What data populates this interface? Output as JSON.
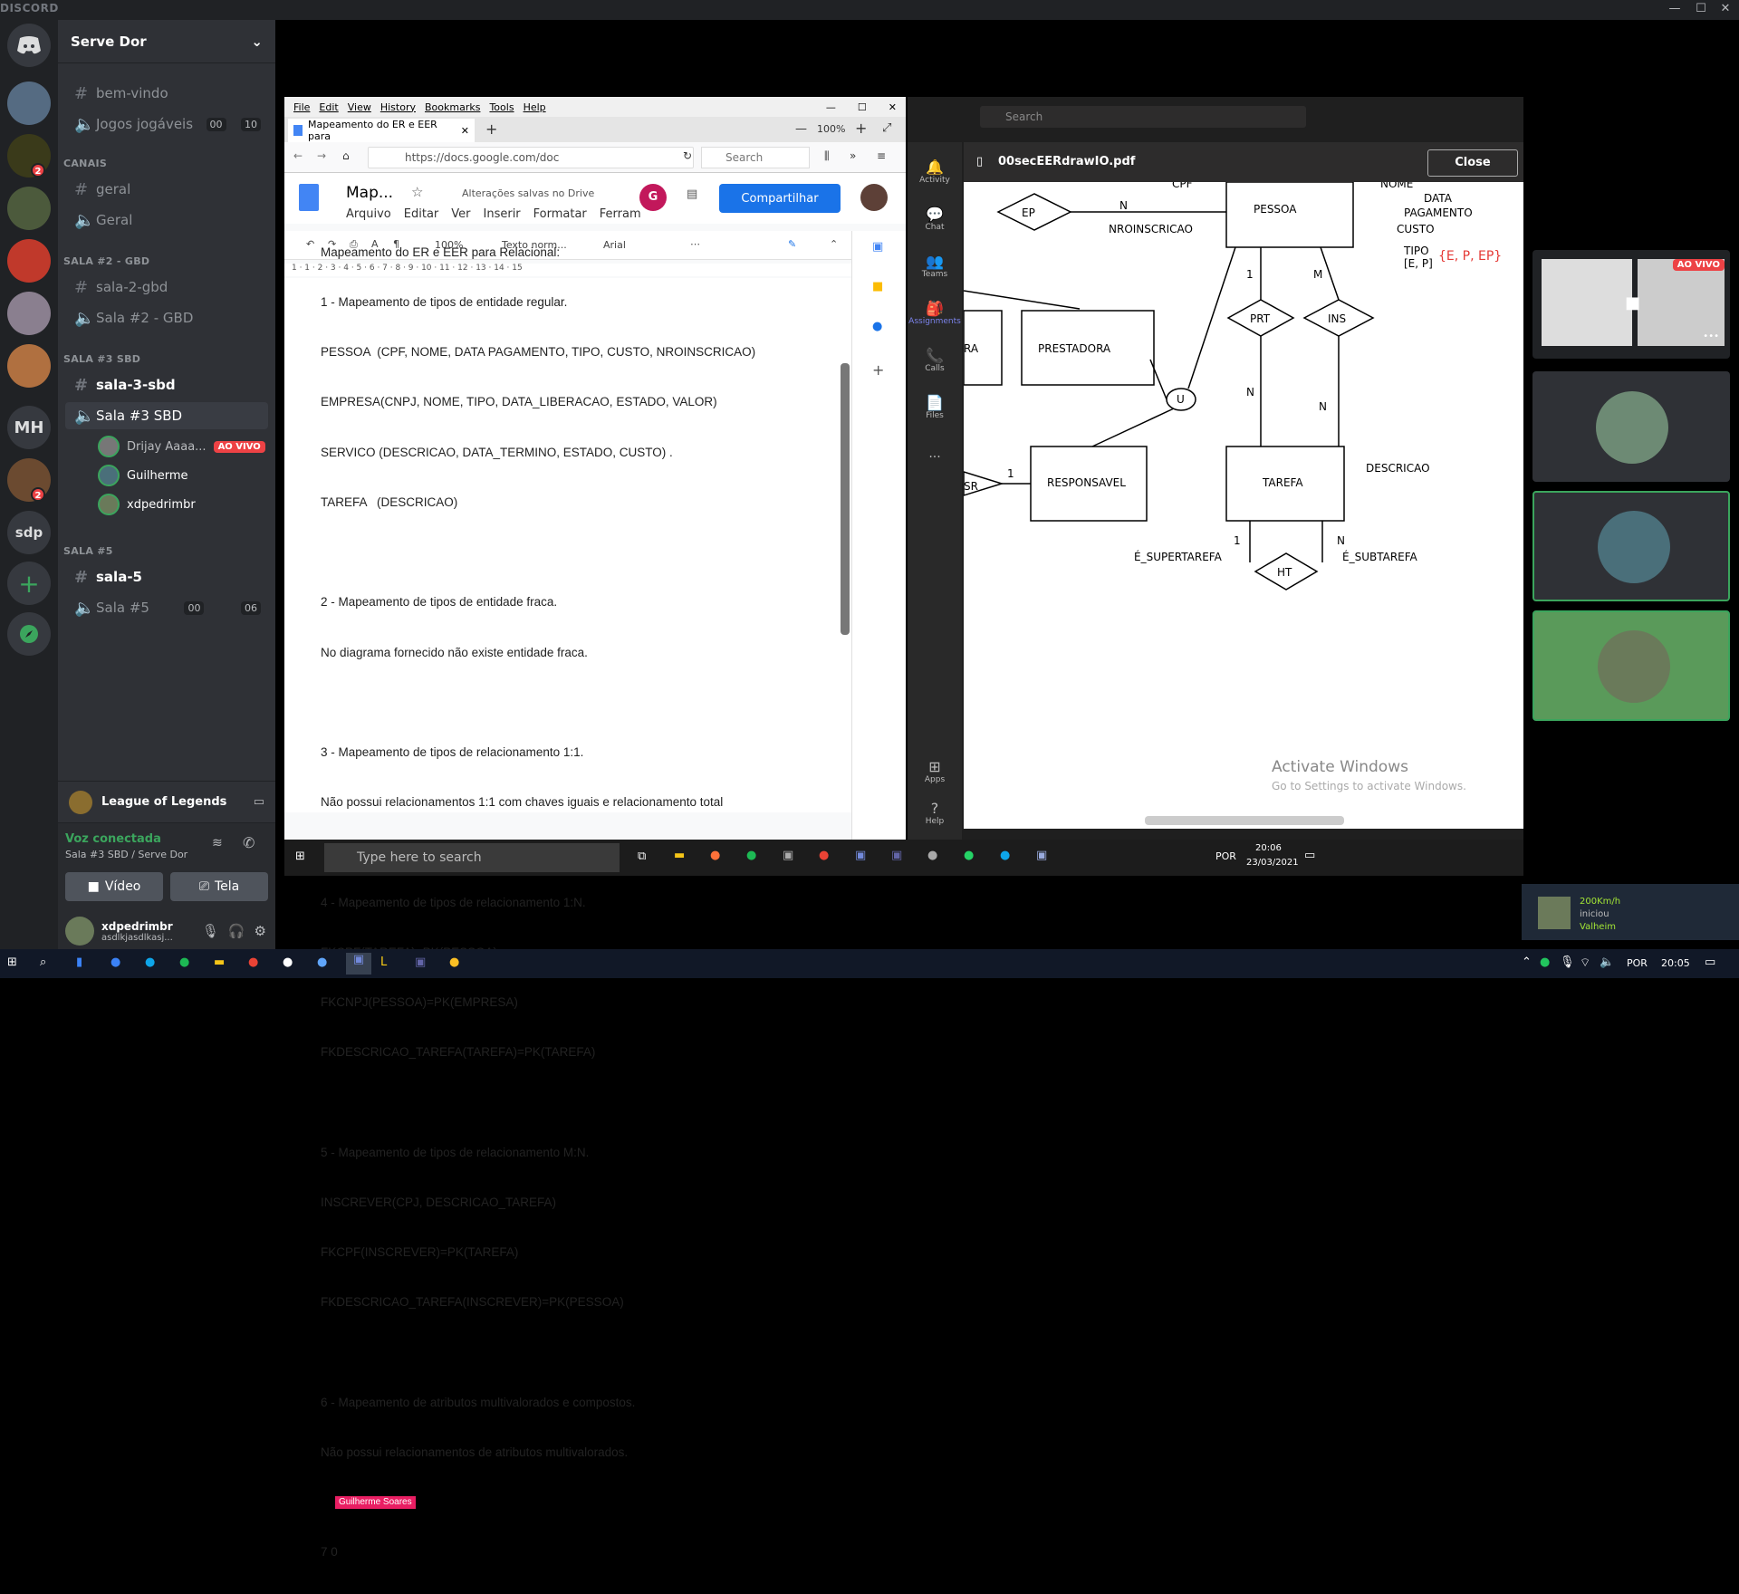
{
  "window": {
    "brand": "DISCORD",
    "min": "—",
    "max": "☐",
    "close": "✕"
  },
  "server": {
    "name": "Serve Dor",
    "chevron": "⌄"
  },
  "guild_badges": [
    "2",
    "2"
  ],
  "guild_labels": {
    "mh": "MH",
    "sdp": "sdp"
  },
  "channels": {
    "bem_vindo": "bem-vindo",
    "jogos": "Jogos jogáveis",
    "jogos_count1": "00",
    "jogos_count2": "10",
    "cat_canais": "CANAIS",
    "geral": "geral",
    "Geral": "Geral",
    "cat_sala2": "SALA #2 - GBD",
    "sala2gbd": "sala-2-gbd",
    "sala2voice": "Sala #2 - GBD",
    "cat_sala3": "SALA #3 SBD",
    "sala3sbd": "sala-3-sbd",
    "sala3voice": "Sala #3 SBD",
    "cat_sala5": "SALA #5",
    "sala5": "sala-5",
    "sala5voice": "Sala #5",
    "sala5_count1": "00",
    "sala5_count2": "06"
  },
  "voice_users": [
    {
      "name": "Drijay Aaaa...",
      "live": "AO VIVO"
    },
    {
      "name": "Guilherme"
    },
    {
      "name": "xdpedrimbr"
    }
  ],
  "activity": {
    "game": "League of Legends"
  },
  "voice": {
    "status": "Voz conectada",
    "where": "Sala #3 SBD / Serve Dor",
    "video": "Vídeo",
    "screen": "Tela"
  },
  "user": {
    "name": "xdpedrimbr",
    "status": "asdlkjasdlkasj..."
  },
  "firefox": {
    "menus": [
      "File",
      "Edit",
      "View",
      "History",
      "Bookmarks",
      "Tools",
      "Help"
    ],
    "tab_title": "Mapeamento do ER e EER para",
    "zoom": "100%",
    "url": "https://docs.google.com/doc",
    "search_placeholder": "Search"
  },
  "gdocs": {
    "title": "Map...",
    "saved": "Alterações salvas no Drive",
    "menus": [
      "Arquivo",
      "Editar",
      "Ver",
      "Inserir",
      "Formatar",
      "Ferram"
    ],
    "share": "Compartilhar",
    "avatar_letter": "G",
    "zoom": "100%",
    "style": "Texto norm...",
    "font": "Arial",
    "ruler": "1  ·  1  ·  2  ·  3  ·  4  ·  5  ·  6  ·  7  ·  8  ·  9  ·  10  ·  11  ·  12  ·  13  ·  14  ·  15",
    "cursor_label": "Guilherme Soares",
    "lines": [
      "Mapeamento do ER e EER para Relacional:",
      "1 - Mapeamento de tipos de entidade regular.",
      "PESSOA  (CPF, NOME, DATA PAGAMENTO, TIPO, CUSTO, NROINSCRICAO)",
      "EMPRESA(CNPJ, NOME, TIPO, DATA_LIBERACAO, ESTADO, VALOR)",
      "SERVICO (DESCRICAO, DATA_TERMINO, ESTADO, CUSTO) .",
      "TAREFA   (DESCRICAO)",
      "",
      "2 - Mapeamento de tipos de entidade fraca.",
      "No diagrama fornecido não existe entidade fraca.",
      "",
      "3 - Mapeamento de tipos de relacionamento 1:1.",
      "Não possui relacionamentos 1:1 com chaves iguais e relacionamento total",
      "",
      "4 - Mapeamento de tipos de relacionamento 1:N.",
      "FKCPF(TAREFA)=PK(PESSOA)",
      "FKCNPJ(PESSOA)=PK(EMPRESA)",
      "FKDESCRICAO_TAREFA(TAREFA)=PK(TAREFA)",
      "",
      "5 - Mapeamento de tipos de relacionamento M:N.",
      "INSCREVER(CPJ, DESCRICAO_TAREFA)",
      "FKCPF(INSCREVER)=PK(TAREFA)",
      "FKDESCRICAO_TAREFA(INSCREVER)=PK(PESSOA)",
      "",
      "6 - Mapeamento de atributos multivalorados e compostos.",
      "Não possui relacionamentos de atributos multivalorados.",
      "",
      "7 0"
    ]
  },
  "teams": {
    "search": "Search",
    "rail": [
      "Activity",
      "Chat",
      "Teams",
      "Assignments",
      "Calls",
      "Files",
      "...",
      "Apps",
      "Help"
    ],
    "pdf_name": "00secEERdrawIO.pdf",
    "close": "Close",
    "watermark1": "Activate Windows",
    "watermark2": "Go to Settings to activate Windows.",
    "diagram": {
      "entities": [
        "PESSOA",
        "PRESTADORA",
        "RESPONSAVEL",
        "TAREFA",
        "RA",
        "SR"
      ],
      "rels": [
        "EP",
        "PRT",
        "INS",
        "HT",
        "U"
      ],
      "attrs": [
        "CPF",
        "NOME",
        "DATA",
        "PAGAMENTO",
        "CUSTO",
        "TIPO",
        "[E, P]",
        "NROINSCRICAO",
        "DESCRICAO",
        "É_SUPERTAREFA",
        "É_SUBTAREFA"
      ],
      "card": [
        "N",
        "1",
        "M",
        "N",
        "N",
        "1",
        "1",
        "N"
      ],
      "type_set": "{E, P, EP}"
    }
  },
  "inner_taskbar": {
    "search": "Type here to search",
    "lang": "POR",
    "time": "20:06",
    "date": "23/03/2021"
  },
  "tiles": {
    "live": "AO VIVO",
    "more": "•••"
  },
  "notif": {
    "line1": "200Km/h",
    "line2": "iniciou",
    "line3": "Valheim"
  },
  "outer_taskbar": {
    "lang": "POR",
    "time": "20:05"
  },
  "colors": {
    "discord_bg": "#202225",
    "accent": "#5865f2",
    "live": "#ed4245",
    "green": "#3ba55d",
    "share": "#1a73e8",
    "type_set": "#e53935"
  }
}
